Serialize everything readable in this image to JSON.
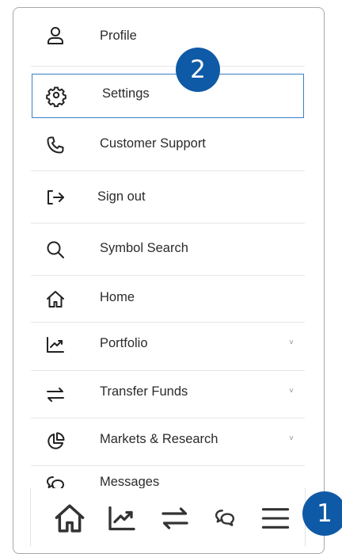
{
  "menu": {
    "items": [
      {
        "label": "Profile",
        "icon": "user-icon"
      },
      {
        "label": "Settings",
        "icon": "gear-icon"
      },
      {
        "label": "Customer Support",
        "icon": "phone-icon"
      },
      {
        "label": "Sign out",
        "icon": "sign-out-icon"
      },
      {
        "label": "Symbol Search",
        "icon": "search-icon"
      },
      {
        "label": "Home",
        "icon": "home-icon"
      },
      {
        "label": "Portfolio",
        "icon": "chart-trend-icon",
        "chevron": "˅"
      },
      {
        "label": "Transfer Funds",
        "icon": "transfer-icon",
        "chevron": "˅"
      },
      {
        "label": "Markets & Research",
        "icon": "pie-chart-icon",
        "chevron": "˅"
      },
      {
        "label": "Messages",
        "icon": "chat-bubbles-icon"
      }
    ]
  },
  "callouts": {
    "settings_step": "2",
    "menu_step": "1"
  },
  "bottom_nav": {
    "items": [
      "home-icon",
      "chart-trend-icon",
      "transfer-icon",
      "chat-bubbles-icon",
      "hamburger-menu-icon"
    ]
  },
  "colors": {
    "accent": "#0f5aa6",
    "active_border": "#3a7fc9"
  }
}
